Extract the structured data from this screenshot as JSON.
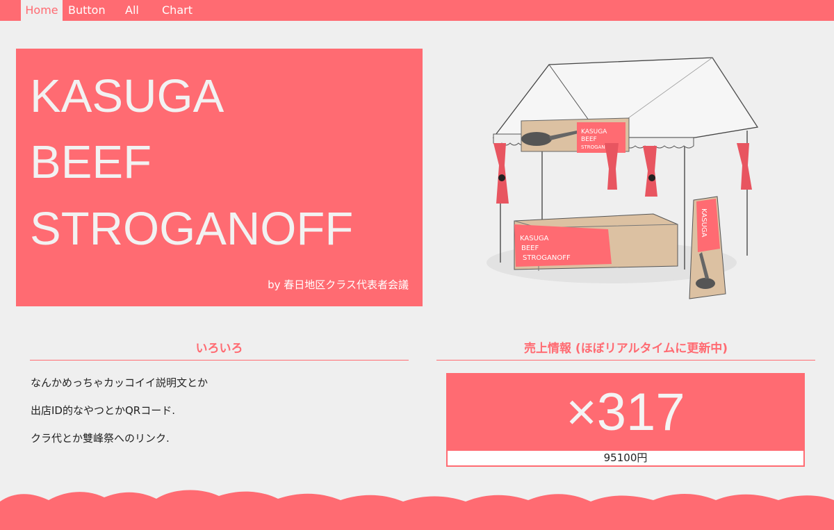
{
  "nav": {
    "items": [
      {
        "label": "Home",
        "active": true
      },
      {
        "label": "Button",
        "active": false
      },
      {
        "label": "All",
        "active": false
      },
      {
        "label": "Chart",
        "active": false
      }
    ]
  },
  "hero": {
    "title_lines": [
      "KASUGA",
      "BEEF",
      "STROGANOFF"
    ],
    "byline": "by 春日地区クラス代表者会議"
  },
  "illustration": {
    "banner_text": [
      "KASUGA",
      "BEEF",
      "STROGANOFF"
    ],
    "table_text": [
      "KASUGA",
      "BEEF",
      "STROGANOFF"
    ],
    "sign_text": "KASUGA"
  },
  "info": {
    "title": "いろいろ",
    "lines": [
      "なんかめっちゃカッコイイ説明文とか",
      "出店ID的なやつとかQRコード.",
      "クラ代とか雙峰祭へのリンク."
    ]
  },
  "sales": {
    "title": "売上情報 (ほぼリアルタイムに更新中)",
    "count": "×317",
    "amount": "95100円"
  },
  "colors": {
    "accent": "#ff6b72",
    "background": "#efefef",
    "hero_text": "#f2f2f2"
  }
}
